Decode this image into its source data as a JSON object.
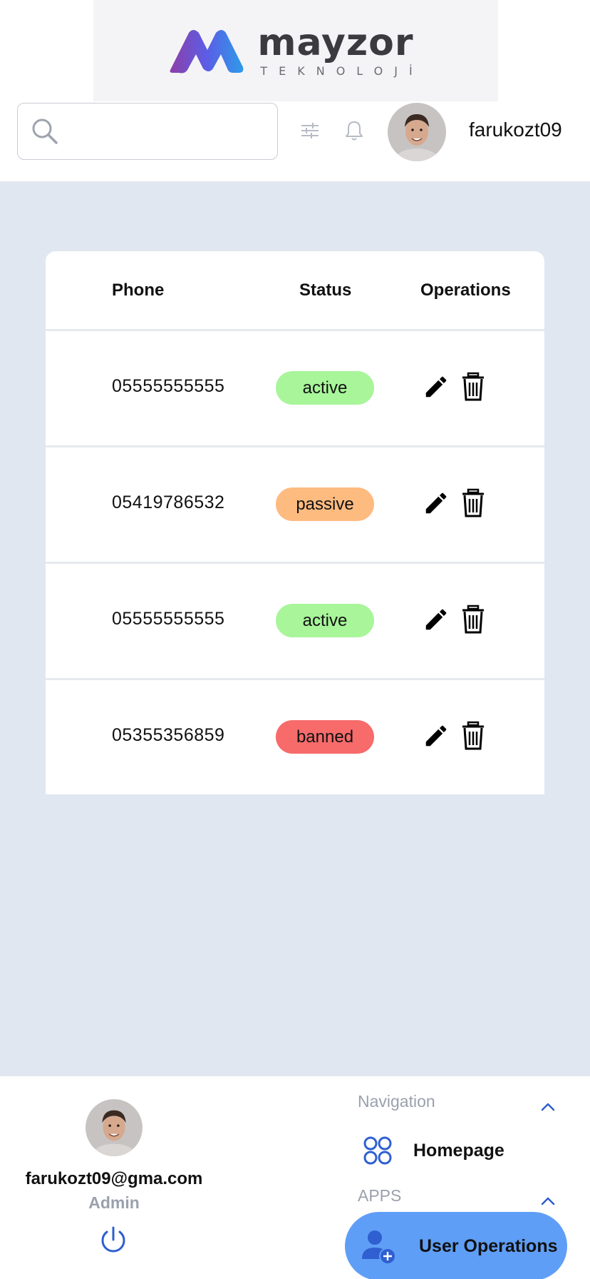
{
  "header": {
    "logo_name": "mayzor",
    "logo_sub": "TEKNOLOJİ",
    "search_placeholder": "",
    "username": "farukozt09"
  },
  "table": {
    "columns": [
      "Phone",
      "Status",
      "Operations"
    ],
    "rows": [
      {
        "phone": "05555555555",
        "status": "active",
        "status_color": "#a8f59a"
      },
      {
        "phone": "05419786532",
        "status": "passive",
        "status_color": "#fdbb80"
      },
      {
        "phone": "05555555555",
        "status": "active",
        "status_color": "#a8f59a"
      },
      {
        "phone": "05355356859",
        "status": "banned",
        "status_color": "#f76b6b"
      }
    ],
    "operations_icons": [
      "pencil-icon",
      "trash-icon"
    ]
  },
  "profile": {
    "email": "farukozt09@gma.com",
    "role": "Admin"
  },
  "nav": {
    "section_navigation": "Navigation",
    "homepage_label": "Homepage",
    "section_apps": "APPS",
    "user_operations_label": "User Operations"
  },
  "colors": {
    "accent": "#2f5fd0",
    "active_nav_bg": "#5f9ef6",
    "content_bg": "#e1e7f0",
    "muted_text": "#9aa1ad"
  }
}
